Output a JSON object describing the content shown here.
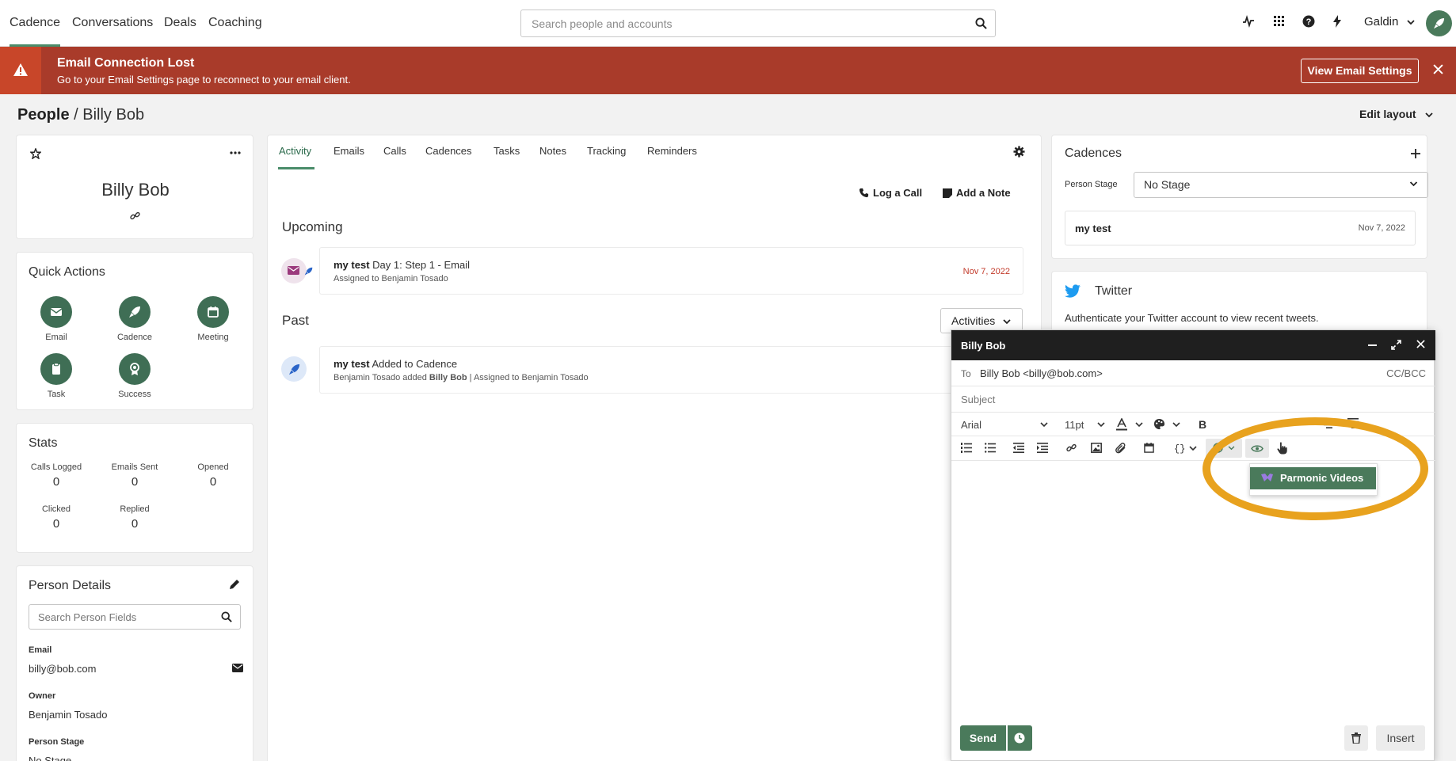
{
  "nav": {
    "tabs": [
      "Cadence",
      "Conversations",
      "Deals",
      "Coaching"
    ],
    "search_placeholder": "Search people and accounts",
    "icons": [
      "activity-icon",
      "apps-grid-icon",
      "help-icon",
      "bolt-icon"
    ],
    "user": "Galdin"
  },
  "banner": {
    "title": "Email Connection Lost",
    "text": "Go to your Email Settings page to reconnect to your email client.",
    "button": "View Email Settings"
  },
  "breadcrumb": {
    "section": "People",
    "separator": "/",
    "name": "Billy Bob"
  },
  "edit_layout": "Edit layout",
  "profile": {
    "name": "Billy Bob"
  },
  "quick_actions": {
    "title": "Quick Actions",
    "items": [
      {
        "label": "Email",
        "icon": "email-icon"
      },
      {
        "label": "Cadence",
        "icon": "rocket-icon"
      },
      {
        "label": "Meeting",
        "icon": "calendar-icon"
      },
      {
        "label": "Task",
        "icon": "clipboard-icon"
      },
      {
        "label": "Success",
        "icon": "award-icon"
      }
    ]
  },
  "stats": {
    "title": "Stats",
    "items": [
      {
        "label": "Calls Logged",
        "value": "0"
      },
      {
        "label": "Emails Sent",
        "value": "0"
      },
      {
        "label": "Opened",
        "value": "0"
      },
      {
        "label": "Clicked",
        "value": "0"
      },
      {
        "label": "Replied",
        "value": "0"
      }
    ]
  },
  "person_details": {
    "title": "Person Details",
    "search_placeholder": "Search Person Fields",
    "fields": [
      {
        "label": "Email",
        "value": "billy@bob.com"
      },
      {
        "label": "Owner",
        "value": "Benjamin Tosado"
      },
      {
        "label": "Person Stage",
        "value": "No Stage"
      }
    ]
  },
  "activity_tabs": [
    "Activity",
    "Emails",
    "Calls",
    "Cadences",
    "Tasks",
    "Notes",
    "Tracking",
    "Reminders"
  ],
  "actions": {
    "log_call": "Log a Call",
    "add_note": "Add a Note"
  },
  "upcoming": {
    "heading": "Upcoming",
    "item": {
      "cadence": "my test",
      "title": "Day 1: Step 1 - Email",
      "sub": "Assigned to Benjamin Tosado",
      "date": "Nov 7, 2022"
    }
  },
  "past": {
    "heading": "Past",
    "filter": "Activities",
    "item": {
      "cadence": "my test",
      "title": "Added to Cadence",
      "sub_prefix": "Benjamin Tosado added",
      "sub_person": "Billy Bob",
      "sub_suffix": "| Assigned to Benjamin Tosado"
    }
  },
  "cadences_panel": {
    "title": "Cadences",
    "stage_label": "Person Stage",
    "stage_value": "No Stage",
    "item": {
      "name": "my test",
      "date": "Nov 7, 2022"
    }
  },
  "twitter": {
    "title": "Twitter",
    "text": "Authenticate your Twitter account to view recent tweets."
  },
  "composer": {
    "title": "Billy Bob",
    "to_label": "To",
    "to_value": "Billy Bob <billy@bob.com>",
    "cc_bcc": "CC/BCC",
    "subject_placeholder": "Subject",
    "font": "Arial",
    "size": "11pt",
    "menu_item": "Parmonic Videos",
    "send": "Send",
    "insert": "Insert"
  },
  "colors": {
    "brand_green": "#4a7a5b",
    "banner_red": "#a93b2a",
    "highlight": "#e8a21e",
    "date_red": "#c23a2a"
  }
}
